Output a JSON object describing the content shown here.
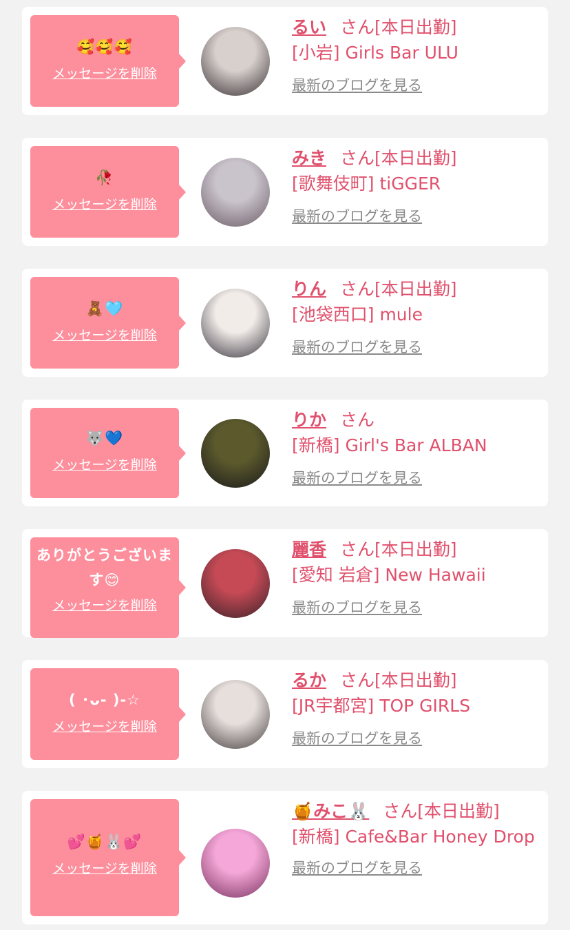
{
  "delete_label": "メッセージを削除",
  "san_label": "さん",
  "on_duty_label": "[本日出勤]",
  "blog_label": "最新のブログを見る",
  "colors": {
    "bubble": "#fd8f9d",
    "accent": "#e0506c",
    "blog_link": "#8a8a8a",
    "page_bg": "#f2f2f2"
  },
  "messages": [
    {
      "message": "🥰🥰🥰",
      "name": "るい",
      "on_duty": true,
      "shop": "[小岩] Girls Bar ULU",
      "avatar_colors": [
        "#d8d0cc",
        "#3a3236"
      ]
    },
    {
      "message": "🥀",
      "name": "みき",
      "on_duty": true,
      "shop": "[歌舞伎町] tiGGER",
      "avatar_colors": [
        "#c9c3cc",
        "#6c5c66"
      ]
    },
    {
      "message": "🧸🩵",
      "name": "りん",
      "on_duty": true,
      "shop": "[池袋西口] mule",
      "avatar_colors": [
        "#f1ece8",
        "#3c3740"
      ]
    },
    {
      "message": "🐺💙",
      "name": "りか",
      "on_duty": false,
      "shop": "[新橋] Girl's Bar ALBAN",
      "avatar_colors": [
        "#5c5a2c",
        "#1a1a1c"
      ]
    },
    {
      "message": "ありがとうございます😊",
      "name": "麗香",
      "on_duty": true,
      "shop": "[愛知 岩倉] New Hawaii",
      "avatar_colors": [
        "#c54a56",
        "#3b2228"
      ]
    },
    {
      "message": "( ･ᴗ- )-☆",
      "name": "るか",
      "on_duty": true,
      "shop": "[JR宇都宮] TOP GIRLS",
      "avatar_colors": [
        "#e6dfdc",
        "#47403f"
      ]
    },
    {
      "message": "💕🍯🐰💕",
      "name": "🍯みこ🐰",
      "on_duty": true,
      "shop": "[新橋] Cafe&Bar Honey Drop",
      "avatar_colors": [
        "#f4a7d8",
        "#7a3360"
      ]
    }
  ]
}
